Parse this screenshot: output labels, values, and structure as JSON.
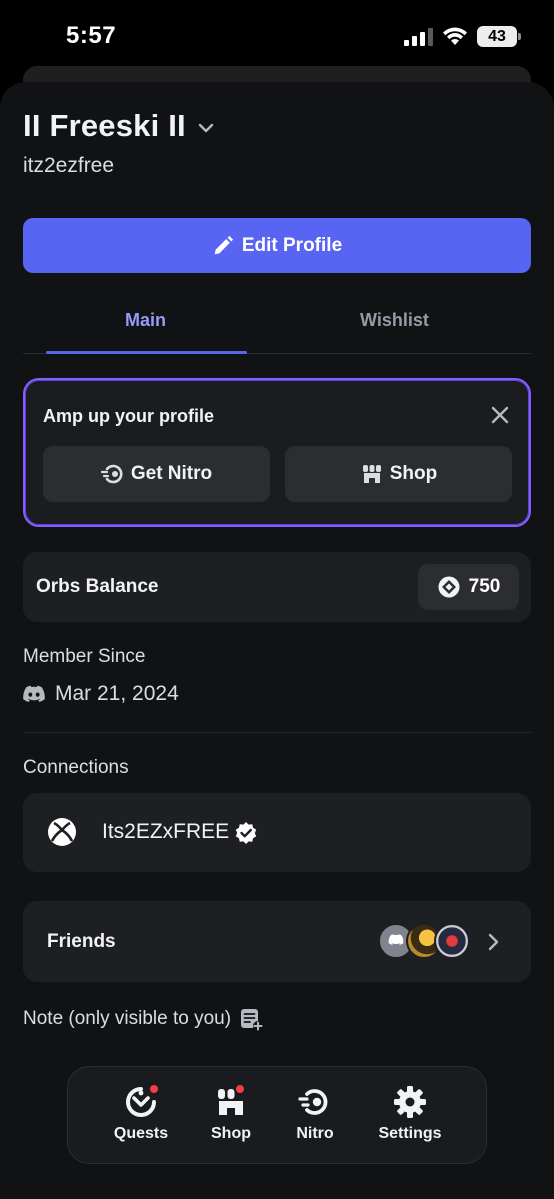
{
  "status_bar": {
    "time": "5:57",
    "battery": "43"
  },
  "profile": {
    "display_name": "II Freeski II",
    "username": "itz2ezfree"
  },
  "edit_profile": {
    "label": "Edit Profile"
  },
  "tabs": [
    {
      "label": "Main",
      "active": true
    },
    {
      "label": "Wishlist",
      "active": false
    }
  ],
  "amp_card": {
    "title": "Amp up your profile",
    "nitro_label": "Get Nitro",
    "shop_label": "Shop"
  },
  "orbs": {
    "label": "Orbs Balance",
    "value": "750"
  },
  "member_since": {
    "label": "Member Since",
    "date": "Mar 21, 2024"
  },
  "connections": {
    "label": "Connections",
    "items": [
      {
        "service": "xbox-icon",
        "name": "Its2EZxFREE",
        "verified": true
      }
    ]
  },
  "friends": {
    "label": "Friends",
    "avatar_count": 3
  },
  "note": {
    "label": "Note (only visible to you)"
  },
  "bottom_nav": {
    "items": [
      {
        "label": "Quests",
        "icon": "quests-icon",
        "badge": true
      },
      {
        "label": "Shop",
        "icon": "shop-icon",
        "badge": true
      },
      {
        "label": "Nitro",
        "icon": "nitro-icon",
        "badge": false
      },
      {
        "label": "Settings",
        "icon": "gear-icon",
        "badge": false
      }
    ]
  },
  "colors": {
    "accent": "#5865f2",
    "accent_text": "#949cf7",
    "amp_border": "#8b5cf6",
    "badge": "#f23f43",
    "background": "#111214",
    "card": "#1e1f22"
  }
}
